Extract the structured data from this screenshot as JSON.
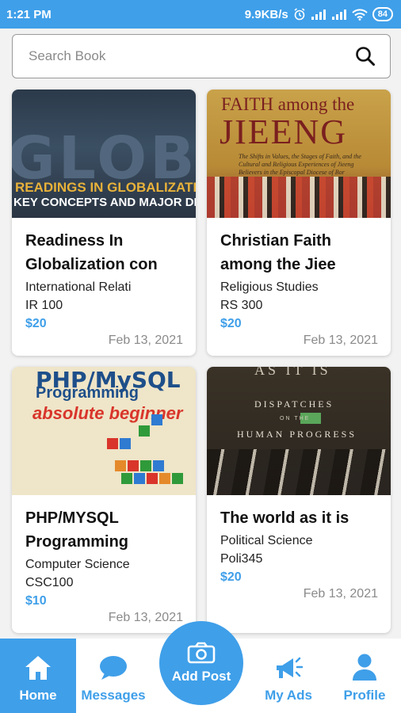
{
  "status_bar": {
    "time": "1:21 PM",
    "network_speed": "9.9KB/s",
    "battery": "84",
    "icons": [
      "alarm-icon",
      "signal-icon",
      "signal-icon",
      "wifi-icon",
      "battery-icon"
    ]
  },
  "search": {
    "placeholder": "Search Book",
    "icon": "search-icon"
  },
  "books": [
    {
      "title_line1": "Readiness In",
      "title_line2": "Globalization con",
      "category": "International Relati",
      "code": "IR 100",
      "price": "$20",
      "date": "Feb 13, 2021",
      "cover": {
        "line1": "GLOBAL",
        "line2": "READINGS IN GLOBALIZATION",
        "line3": "KEY CONCEPTS AND MAJOR DEBATES"
      }
    },
    {
      "title_line1": "Christian Faith",
      "title_line2": "among the Jiee",
      "category": "Religious Studies",
      "code": "RS 300",
      "price": "$20",
      "date": "Feb 13, 2021",
      "cover": {
        "line1": "FAITH among the",
        "line2": "JIEENG",
        "line3": "The Shifts in Values, the Stages of Faith, and the Cultural and Religious Experiences of Jieeng Believers in the Episcopal Diocese of Bor"
      }
    },
    {
      "title_line1": "PHP/MYSQL",
      "title_line2": "Programming",
      "category": "Computer Science",
      "code": "CSC100",
      "price": "$10",
      "date": "Feb 13, 2021",
      "cover": {
        "line1": "PHP/MySQL",
        "line2": "Programming",
        "line3": "absolute beginner"
      }
    },
    {
      "title_line1": "The world as it is",
      "title_line2": "",
      "category": "Political Science",
      "code": "Poli345",
      "price": "$20",
      "date": "Feb 13, 2021",
      "cover": {
        "line0": "AS IT IS",
        "line1": "DISPATCHES",
        "line2": "ON THE",
        "line3": "HUMAN PROGRESS"
      }
    }
  ],
  "nav": {
    "home": "Home",
    "messages": "Messages",
    "add_post": "Add Post",
    "my_ads": "My Ads",
    "profile": "Profile"
  },
  "colors": {
    "accent": "#3f9fe9",
    "date_gray": "#8a8a8a"
  }
}
